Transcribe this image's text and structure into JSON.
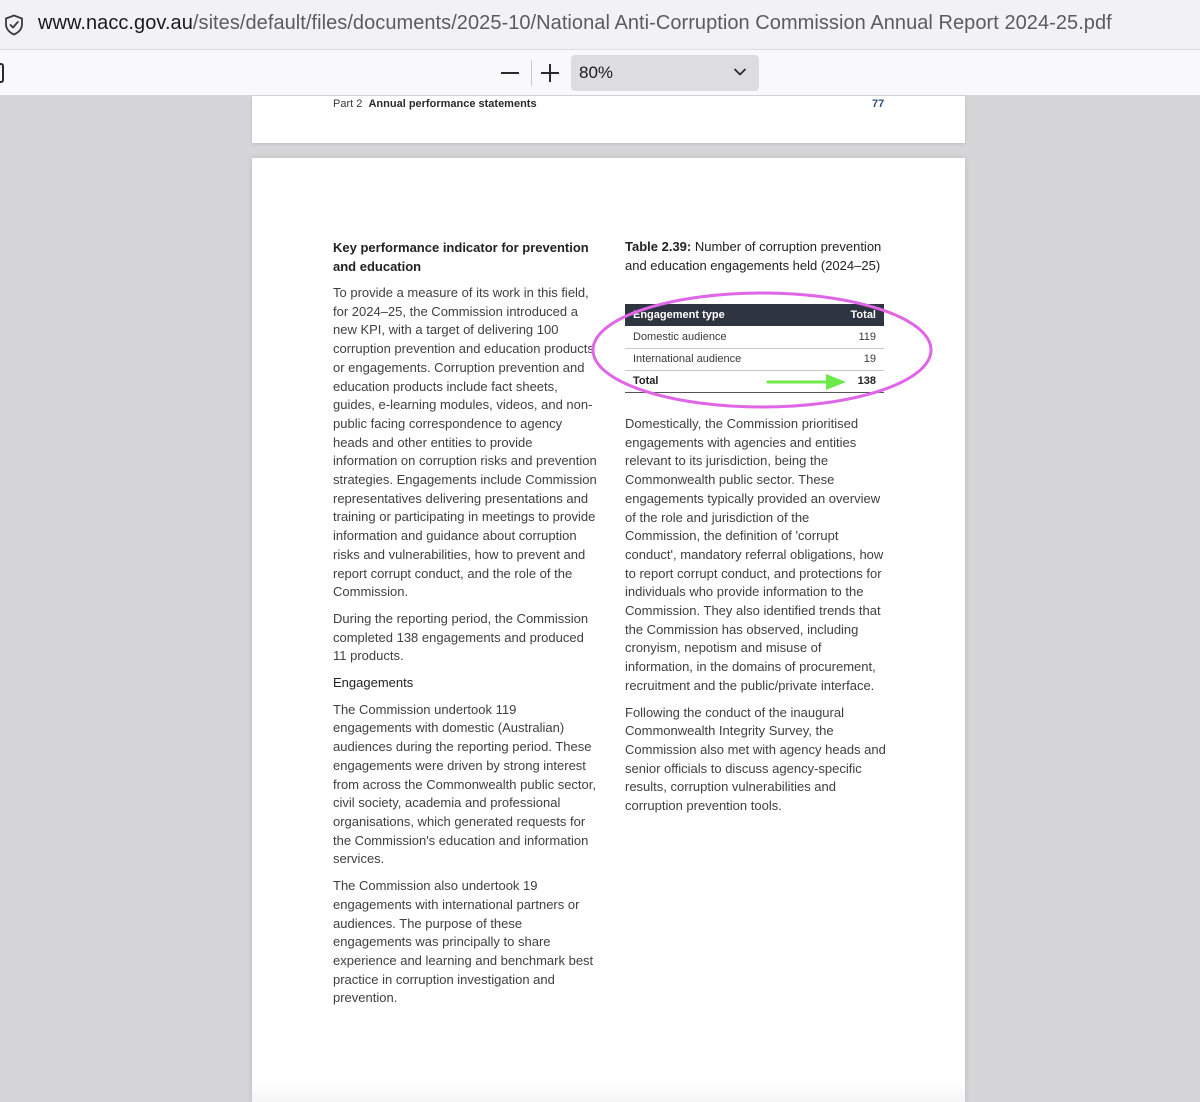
{
  "browser": {
    "url_domain": "www.nacc.gov.au",
    "url_path": "/sites/default/files/documents/2025-10/National Anti-Corruption Commission Annual Report 2024-25.pdf"
  },
  "pdf_toolbar": {
    "zoom_value": "80%"
  },
  "page_header": {
    "part": "Part 2",
    "section": "Annual performance statements",
    "page_number": "77"
  },
  "left_column": {
    "kpi_heading": "Key performance indicator for prevention and education",
    "para1": "To provide a measure of its work in this field, for 2024–25, the Commission introduced a new KPI, with a target of delivering 100 corruption prevention and education products or engagements. Corruption prevention and education products include fact sheets, guides, e-learning modules, videos, and non-public facing correspondence to agency heads and other entities to provide information on corruption risks and prevention strategies. Engagements include Commission representatives delivering presentations and training or participating in meetings to provide information and guidance about corruption risks and vulnerabilities, how to prevent and report corrupt conduct, and the role of the Commission.",
    "para2": "During the reporting period, the Commission completed 138 engagements and produced 11 products.",
    "engagements_heading": "Engagements",
    "para3": "The Commission undertook 119 engagements with domestic (Australian) audiences during the reporting period. These engagements were driven by strong interest from across the Commonwealth public sector, civil society, academia and professional organisations, which generated requests for the Commission's education and information services.",
    "para4": "The Commission also undertook 19 engagements with international partners or audiences. The purpose of these engagements was principally to share experience and learning and benchmark best practice in corruption investigation and prevention."
  },
  "table": {
    "caption_label": "Table 2.39:",
    "caption_text": " Number of corruption prevention and education engagements held (2024–25)",
    "headers": [
      "Engagement type",
      "Total"
    ],
    "rows": [
      {
        "type": "Domestic audience",
        "total": "119"
      },
      {
        "type": "International audience",
        "total": "19"
      }
    ],
    "total_row": {
      "type": "Total",
      "total": "138"
    }
  },
  "right_column": {
    "para1": "Domestically, the Commission prioritised engagements with agencies and entities relevant to its jurisdiction, being the Commonwealth public sector. These engagements typically provided an overview of the role and jurisdiction of the Commission, the definition of 'corrupt conduct', mandatory referral obligations, how to report corrupt conduct, and protections for individuals who provide information to the Commission. They also identified trends that the Commission has observed, including cronyism, nepotism and misuse of information, in the domains of procurement, recruitment and the public/private interface.",
    "para2": "Following the conduct of the inaugural Commonwealth Integrity Survey, the Commission also met with agency heads and senior officials to discuss agency-specific results, corruption vulnerabilities and corruption prevention tools."
  },
  "annotation_colors": {
    "circle": "#e066e8",
    "arrow": "#6ee84a"
  },
  "icons": [
    "shield-icon",
    "sidebar-toggle-icon",
    "zoom-out-icon",
    "zoom-in-icon",
    "chevron-down-icon"
  ]
}
